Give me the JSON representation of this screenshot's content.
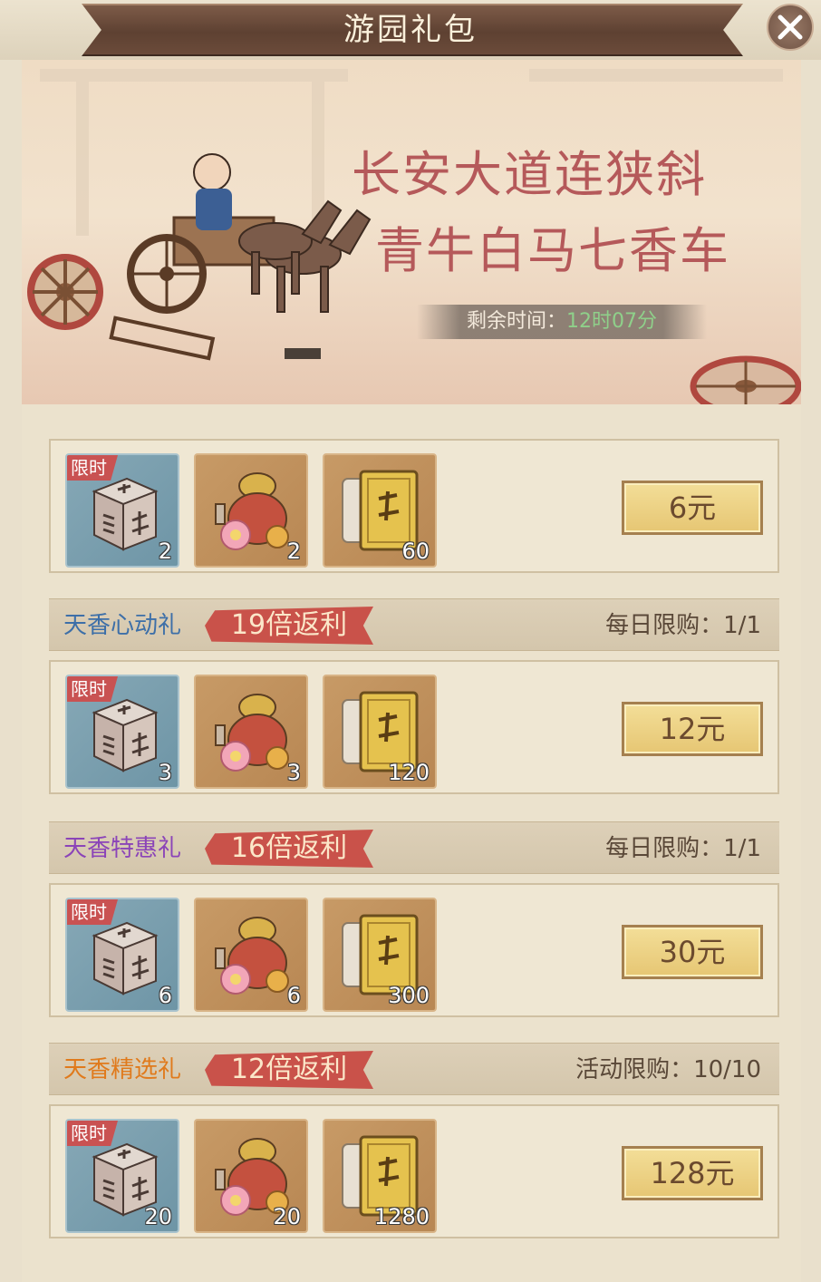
{
  "window": {
    "title": "游园礼包"
  },
  "banner": {
    "line1": "长安大道连狭斜",
    "line2": "青牛白马七香车",
    "timer_label": "剩余时间：",
    "timer_value": "12时07分"
  },
  "common": {
    "limited_tag": "限时"
  },
  "packs": [
    {
      "name": "",
      "rebate": "",
      "limit": "",
      "items": [
        {
          "icon": "dice-icon",
          "count": "2"
        },
        {
          "icon": "flower-bag-icon",
          "count": "2"
        },
        {
          "icon": "golden-book-icon",
          "count": "60"
        }
      ],
      "price": "6元"
    },
    {
      "name": "天香心动礼",
      "name_color": "#3d6fa8",
      "rebate": "19倍返利",
      "limit": "每日限购：1/1",
      "items": [
        {
          "icon": "dice-icon",
          "count": "3"
        },
        {
          "icon": "flower-bag-icon",
          "count": "3"
        },
        {
          "icon": "golden-book-icon",
          "count": "120"
        }
      ],
      "price": "12元"
    },
    {
      "name": "天香特惠礼",
      "name_color": "#8b44b8",
      "rebate": "16倍返利",
      "limit": "每日限购：1/1",
      "items": [
        {
          "icon": "dice-icon",
          "count": "6"
        },
        {
          "icon": "flower-bag-icon",
          "count": "6"
        },
        {
          "icon": "golden-book-icon",
          "count": "300"
        }
      ],
      "price": "30元"
    },
    {
      "name": "天香精选礼",
      "name_color": "#e07a1c",
      "rebate": "12倍返利",
      "limit": "活动限购：10/10",
      "items": [
        {
          "icon": "dice-icon",
          "count": "20"
        },
        {
          "icon": "flower-bag-icon",
          "count": "20"
        },
        {
          "icon": "golden-book-icon",
          "count": "1280"
        }
      ],
      "price": "128元"
    }
  ]
}
